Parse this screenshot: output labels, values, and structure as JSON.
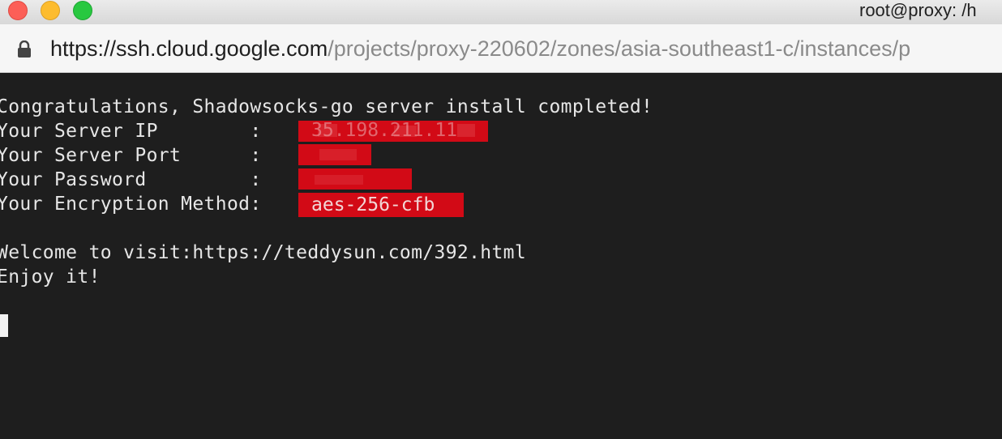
{
  "window": {
    "title": "root@proxy: /h"
  },
  "address_bar": {
    "url_host": "https://ssh.cloud.google.com",
    "url_path": "/projects/proxy-220602/zones/asia-southeast1-c/instances/p"
  },
  "terminal": {
    "lines": [
      "Congratulations, Shadowsocks-go server install completed!",
      "Your Server IP        : ",
      "Your Server Port      : ",
      "Your Password         : ",
      "Your Encryption Method: ",
      "",
      "Welcome to visit:https://teddysun.com/392.html",
      "Enjoy it!"
    ],
    "encryption_method": "aes-256-cfb",
    "server_ip_fragment": "35.198.211.11"
  },
  "colors": {
    "terminal_bg": "#1e1e1e",
    "terminal_fg": "#e6e6e6",
    "redaction": "#d20a16"
  }
}
